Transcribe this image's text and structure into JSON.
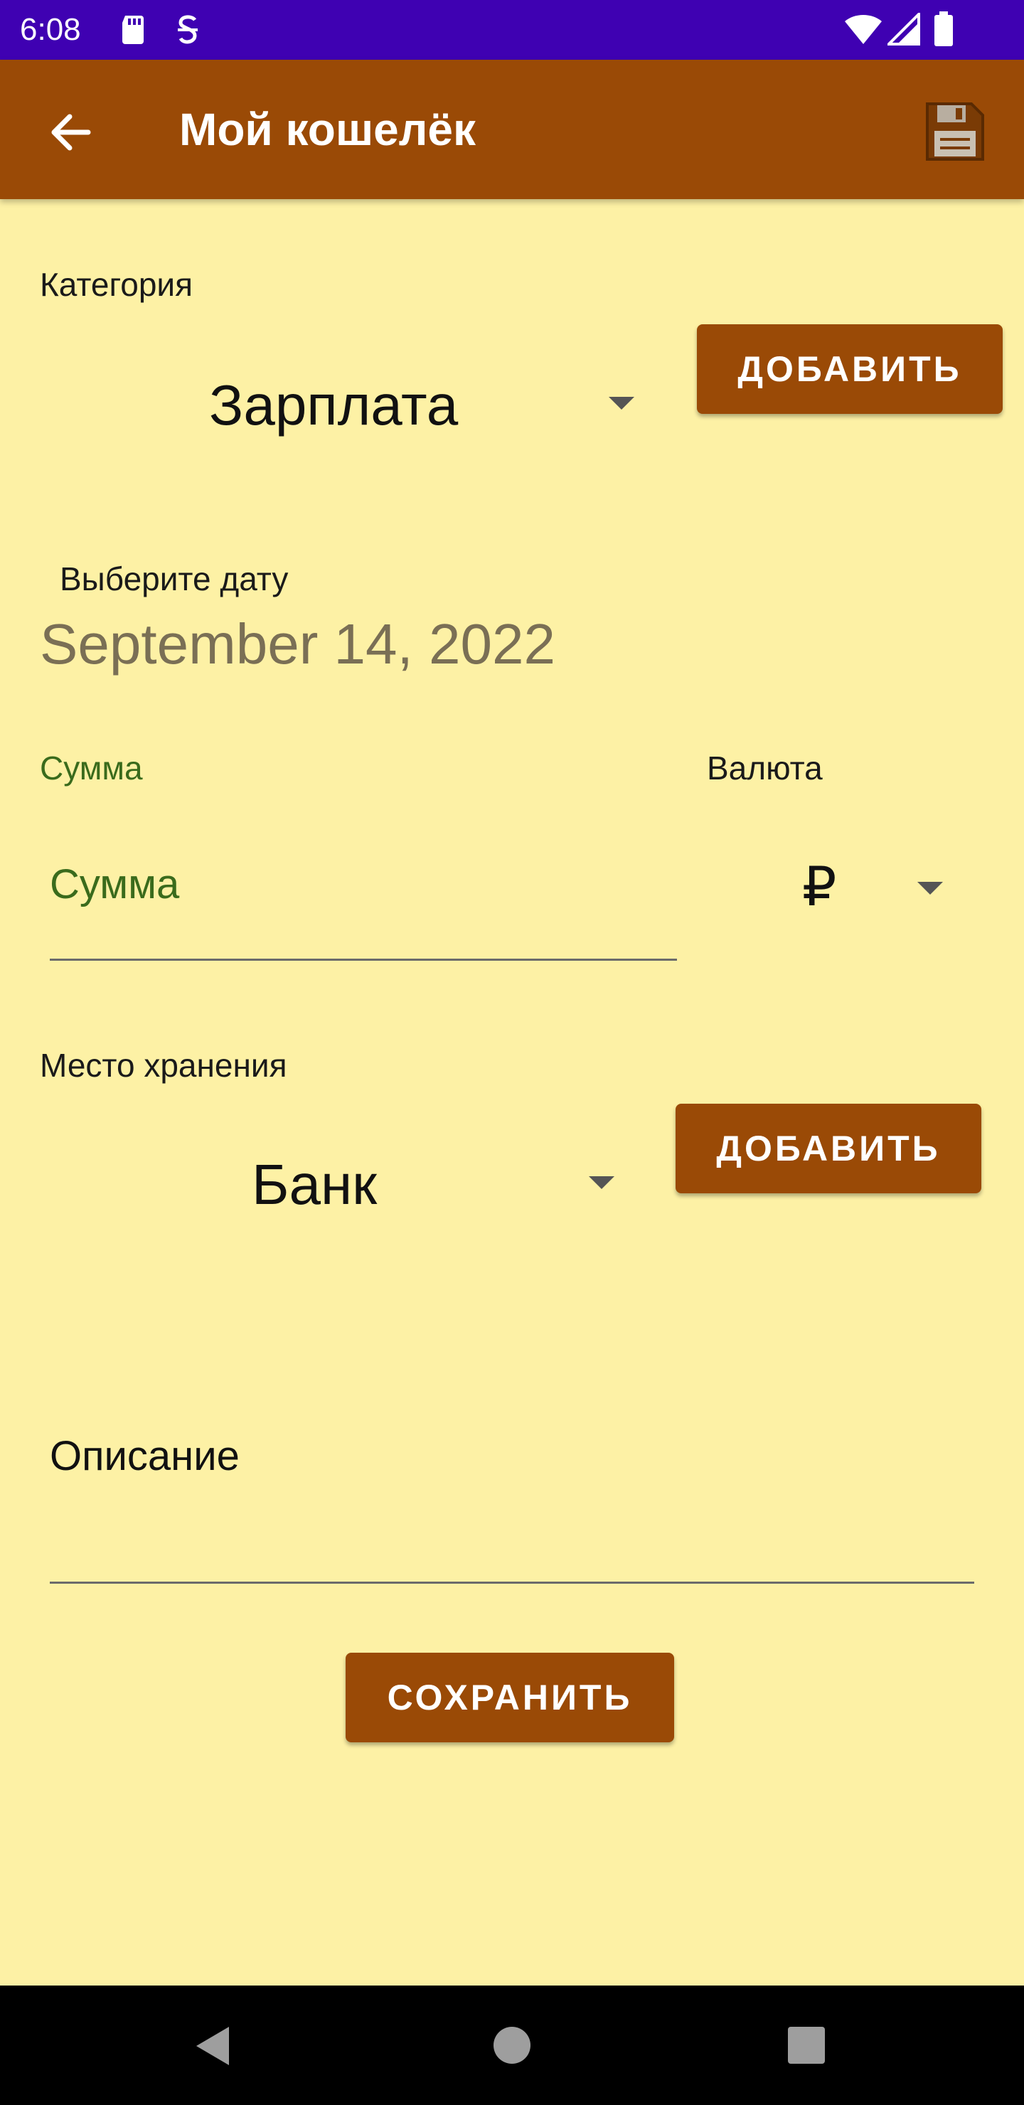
{
  "status_bar": {
    "time": "6:08",
    "icons": [
      "sd-card-icon",
      "sync-icon",
      "wifi-icon",
      "signal-icon",
      "battery-icon"
    ]
  },
  "app_bar": {
    "title": "Мой кошелёк",
    "back_icon": "arrow-back-icon",
    "save_icon": "floppy-save-icon"
  },
  "category": {
    "label": "Категория",
    "selected": "Зарплата",
    "add_button": "ДОБАВИТЬ"
  },
  "date": {
    "label": "Выберите дату",
    "value": "September 14, 2022"
  },
  "amount": {
    "label": "Сумма",
    "placeholder": "Сумма"
  },
  "currency": {
    "label": "Валюта",
    "selected": "₽"
  },
  "storage": {
    "label": "Место хранения",
    "selected": "Банк",
    "add_button": "ДОБАВИТЬ"
  },
  "description": {
    "placeholder": "Описание"
  },
  "save_button": "СОХРАНИТЬ",
  "colors": {
    "status_bar": "#3F01B2",
    "app_bar": "#9A4A06",
    "background": "#FDF1A5",
    "button": "#9A4A06",
    "accent_green": "#3A6B1C",
    "date_text": "#7A6F55"
  }
}
